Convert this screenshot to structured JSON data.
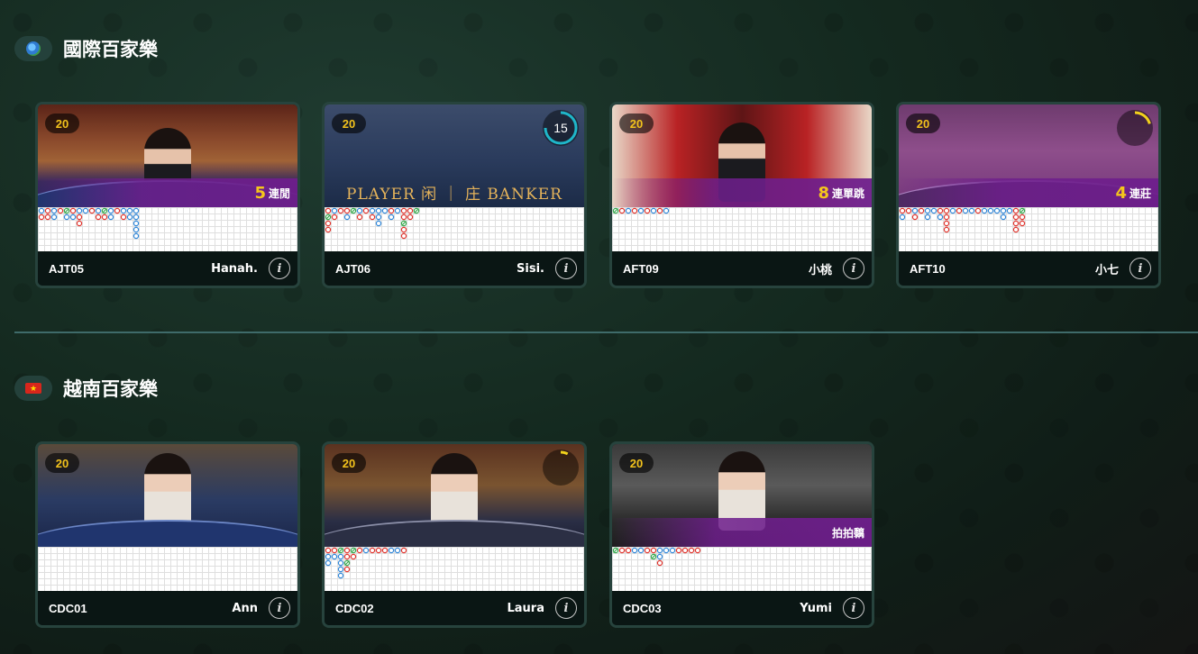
{
  "sections": [
    {
      "title": "國際百家樂",
      "icon": "globe-icon",
      "tables": [
        {
          "id": "AJT05",
          "dealer": "Hanah.",
          "limit_badge": "20",
          "streak_num": "5",
          "streak_label": "連閒",
          "has_timer": false,
          "road": [
            [
              "pl",
              "bk"
            ],
            [
              "bk",
              "bk"
            ],
            [
              "pl",
              "pl"
            ],
            [
              "bk"
            ],
            [
              "tie",
              "pl"
            ],
            [
              "bk",
              "pl"
            ],
            [
              "pl",
              "bk",
              "bk"
            ],
            [
              "pl"
            ],
            [
              "bk"
            ],
            [
              "pl",
              "bk"
            ],
            [
              "tie",
              "bk"
            ],
            [
              "pl",
              "pl"
            ],
            [
              "bk"
            ],
            [
              "pl",
              "bk"
            ],
            [
              "pl",
              "pl"
            ],
            [
              "pl",
              "pl",
              "pl",
              "pl",
              "pl"
            ]
          ]
        },
        {
          "id": "AJT06",
          "dealer": "Sisi.",
          "limit_badge": "20",
          "timer": "15",
          "has_timer": true,
          "road": [
            [
              "bk",
              "tie",
              "bk",
              "bk"
            ],
            [
              "pl",
              "bk"
            ],
            [
              "bk"
            ],
            [
              "bk",
              "pl"
            ],
            [
              "tie"
            ],
            [
              "pl",
              "bk"
            ],
            [
              "bk"
            ],
            [
              "pl",
              "bk"
            ],
            [
              "pl",
              "pl",
              "pl"
            ],
            [
              "pl"
            ],
            [
              "bk",
              "pl"
            ],
            [
              "pl"
            ],
            [
              "bk",
              "bk",
              "tie",
              "bk",
              "bk"
            ],
            [
              "bk",
              "bk"
            ],
            [
              "tie"
            ]
          ]
        },
        {
          "id": "AFT09",
          "dealer": "小桃",
          "limit_badge": "20",
          "streak_num": "8",
          "streak_label": "連單跳",
          "has_timer": false,
          "road": [
            [
              "tie"
            ],
            [
              "bk"
            ],
            [
              "pl"
            ],
            [
              "bk"
            ],
            [
              "pl"
            ],
            [
              "bk"
            ],
            [
              "pl"
            ],
            [
              "bk"
            ],
            [
              "pl"
            ]
          ]
        },
        {
          "id": "AFT10",
          "dealer": "小七",
          "limit_badge": "20",
          "streak_num": "4",
          "streak_label": "連莊",
          "has_timer": true,
          "road": [
            [
              "bk",
              "pl"
            ],
            [
              "bk"
            ],
            [
              "pl",
              "bk"
            ],
            [
              "bk"
            ],
            [
              "pl",
              "pl"
            ],
            [
              "pl"
            ],
            [
              "bk",
              "pl"
            ],
            [
              "bk",
              "bk",
              "bk",
              "bk"
            ],
            [
              "pl"
            ],
            [
              "bk"
            ],
            [
              "pl"
            ],
            [
              "pl"
            ],
            [
              "bk"
            ],
            [
              "pl"
            ],
            [
              "pl"
            ],
            [
              "pl"
            ],
            [
              "pl",
              "pl"
            ],
            [
              "pl"
            ],
            [
              "bk",
              "bk",
              "bk",
              "bk"
            ],
            [
              "tie",
              "bk",
              "bk"
            ]
          ]
        }
      ]
    },
    {
      "title": "越南百家樂",
      "icon": "vietnam-flag-icon",
      "tables": [
        {
          "id": "CDC01",
          "dealer": "Ann",
          "limit_badge": "20",
          "has_timer": false,
          "road": []
        },
        {
          "id": "CDC02",
          "dealer": "Laura",
          "limit_badge": "20",
          "has_timer": true,
          "road": [
            [
              "bk",
              "pl",
              "pl"
            ],
            [
              "bk",
              "pl"
            ],
            [
              "tie",
              "pl",
              "pl",
              "pl",
              "pl"
            ],
            [
              "bk",
              "bk",
              "tie",
              "bk"
            ],
            [
              "tie",
              "bk"
            ],
            [
              "bk"
            ],
            [
              "pl"
            ],
            [
              "bk"
            ],
            [
              "bk"
            ],
            [
              "bk"
            ],
            [
              "pl"
            ],
            [
              "pl"
            ],
            [
              "bk"
            ]
          ]
        },
        {
          "id": "CDC03",
          "dealer": "Yumi",
          "limit_badge": "20",
          "streak_label": "拍拍黐",
          "has_timer": false,
          "road": [
            [
              "tie"
            ],
            [
              "bk"
            ],
            [
              "bk"
            ],
            [
              "pl"
            ],
            [
              "pl"
            ],
            [
              "bk"
            ],
            [
              "bk",
              "tie"
            ],
            [
              "pl",
              "pl",
              "bk"
            ],
            [
              "pl"
            ],
            [
              "pl"
            ],
            [
              "bk"
            ],
            [
              "bk"
            ],
            [
              "bk"
            ],
            [
              "bk"
            ]
          ]
        }
      ]
    }
  ],
  "colors": {
    "banker": "#e0332c",
    "player": "#2f86d8",
    "tie": "#36a84d",
    "streak_number": "#f4c61c",
    "badge_text": "#f2c21c"
  },
  "video_labels": {
    "ajt06_player_banker": "PLAYER 闲 ｜ 庄 BANKER"
  }
}
